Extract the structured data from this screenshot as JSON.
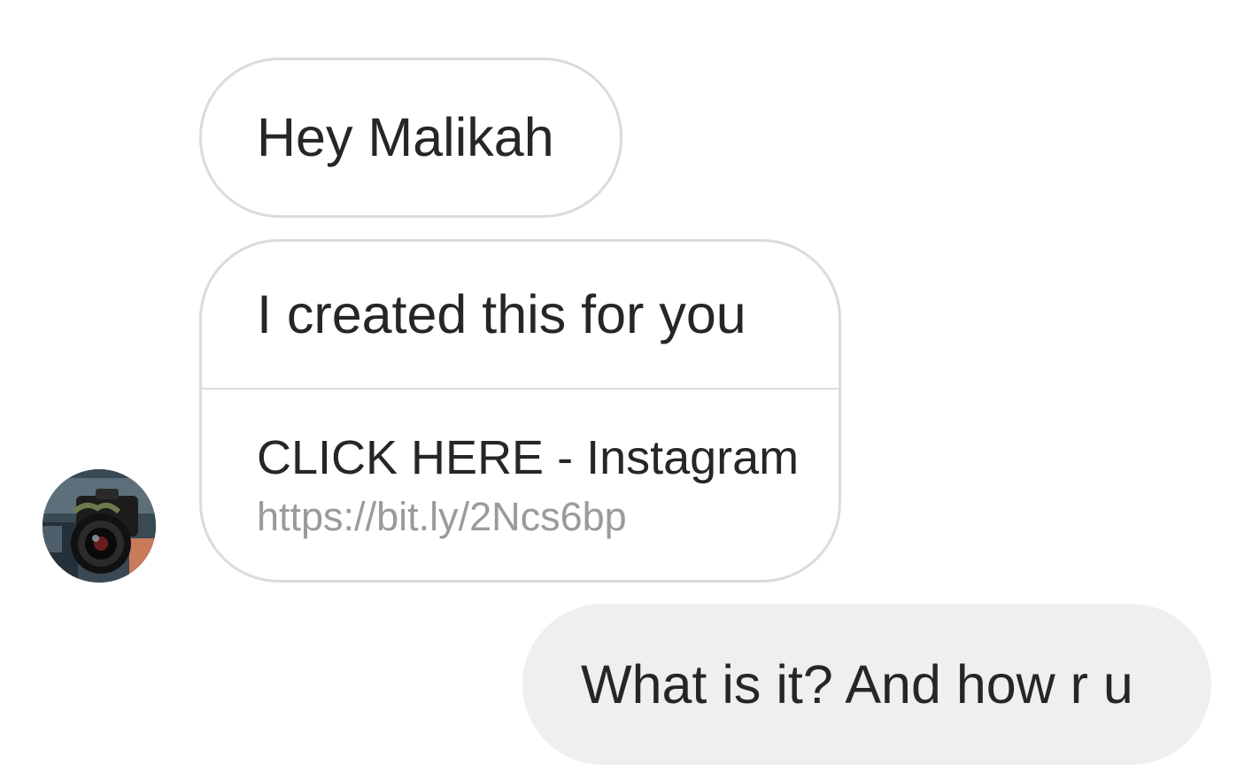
{
  "conversation": {
    "messages": [
      {
        "direction": "received",
        "text": "Hey Malikah"
      },
      {
        "direction": "received",
        "text": "I created this for you",
        "link_preview": {
          "title": "CLICK HERE - Instagram",
          "url": "https://bit.ly/2Ncs6bp"
        }
      },
      {
        "direction": "sent",
        "text": "What is it? And how r u"
      }
    ],
    "sender_avatar": {
      "description_icon": "camera-photo-avatar"
    }
  },
  "colors": {
    "received_bubble_bg": "#ffffff",
    "received_bubble_border": "#dbdbdb",
    "sent_bubble_bg": "#efefef",
    "text": "#262626",
    "link_url": "#9a9a9a"
  }
}
